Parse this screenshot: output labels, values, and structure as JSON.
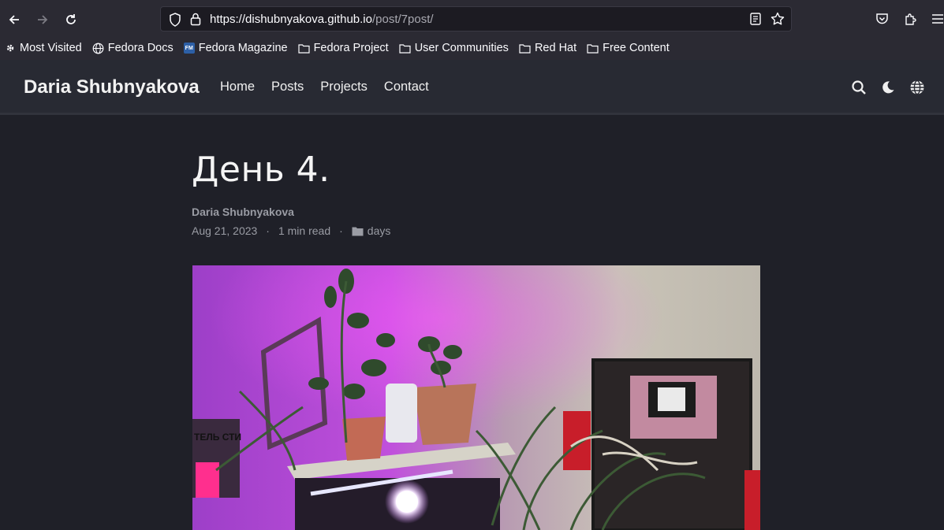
{
  "browser": {
    "url_host": "https://dishubnyakova.github.io",
    "url_path": "/post/7post/",
    "bookmarks": [
      "Most Visited",
      "Fedora Docs",
      "Fedora Magazine",
      "Fedora Project",
      "User Communities",
      "Red Hat",
      "Free Content"
    ],
    "fm_badge": "FM"
  },
  "site": {
    "title": "Daria Shubnyakova",
    "nav": [
      "Home",
      "Posts",
      "Projects",
      "Contact"
    ]
  },
  "post": {
    "title": "День 4.",
    "author": "Daria Shubnyakova",
    "date": "Aug 21, 2023",
    "sep1": "·",
    "read_time": "1 min read",
    "sep2": "·",
    "category": "days"
  },
  "photo_sign": "ТЕЛЬ СТИ"
}
